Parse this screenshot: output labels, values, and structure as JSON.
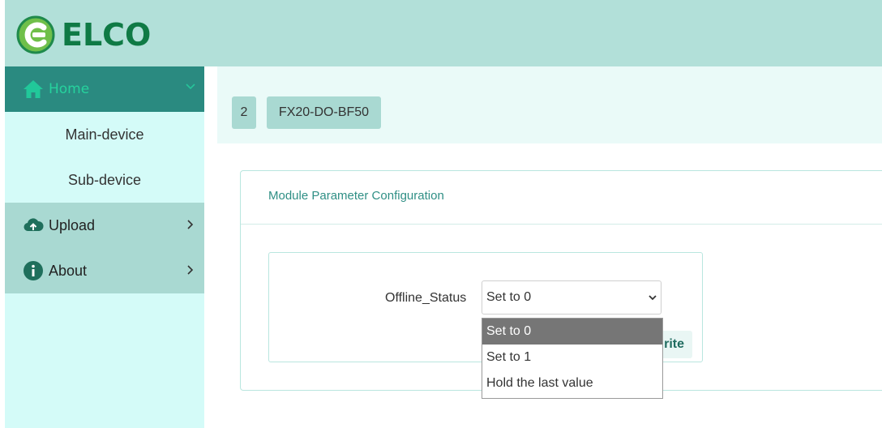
{
  "brand": {
    "name": "ELCO"
  },
  "sidebar": {
    "home": {
      "label": "Home"
    },
    "sub_items": [
      "Main-device",
      "Sub-device"
    ],
    "upload": {
      "label": "Upload"
    },
    "about": {
      "label": "About"
    }
  },
  "header": {
    "device_index": "2",
    "device_name": "FX20-DO-BF50"
  },
  "card": {
    "title": "Module Parameter Configuration",
    "field_label": "Offline_Status",
    "select_value": "Set to 0",
    "write_label": "rite"
  },
  "dropdown": {
    "options": [
      "Set to 0",
      "Set to 1",
      "Hold the last value"
    ],
    "selected": "Set to 0"
  },
  "colors": {
    "topbar": "#b2e0d9",
    "sidebar": "#d4fbf8",
    "active_item": "#2a8a80",
    "brand_green": "#0f7a45"
  }
}
